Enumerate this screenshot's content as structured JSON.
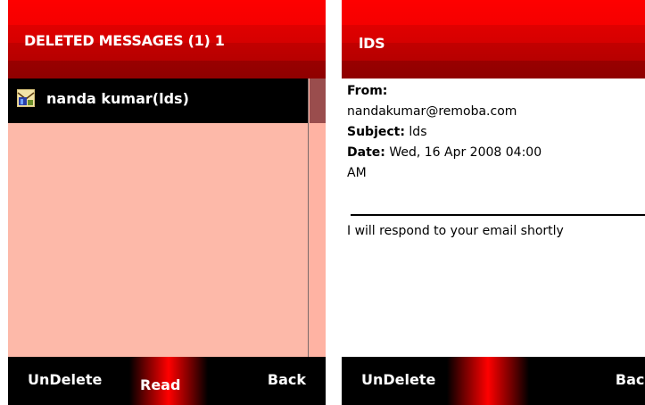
{
  "left_screen": {
    "header_title": "DELETED MESSAGES (1)  1",
    "list_items": [
      {
        "label": "nanda kumar(lds)",
        "icon": "mail-envelope-icon"
      }
    ],
    "softkeys": {
      "left": "UnDelete",
      "center": "Read",
      "right": "Back"
    }
  },
  "right_screen": {
    "header_title": "lDS",
    "from_label": "From:",
    "from_value": "nandakumar@remoba.com",
    "subject_label": "Subject:",
    "subject_value": "lds",
    "date_label": "Date:",
    "date_value": "Wed, 16 Apr 2008 04:00",
    "date_value_cont": "AM",
    "body": "I will respond to your email shortly",
    "softkeys": {
      "left": "UnDelete",
      "right": "Back"
    }
  },
  "colors": {
    "header_red": "#fe0000",
    "list_background": "#fdb9a9",
    "selection": "#000000",
    "softkey_bar": "#000000"
  }
}
